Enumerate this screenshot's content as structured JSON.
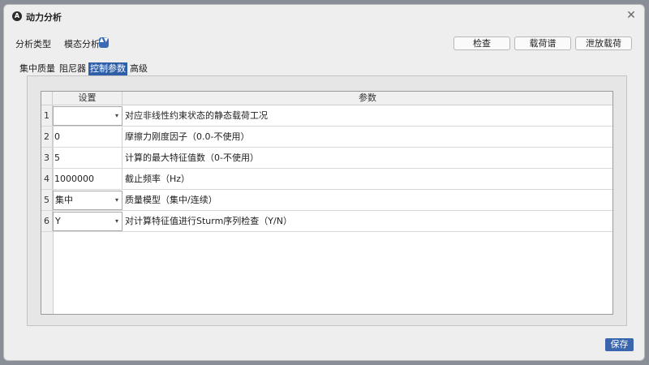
{
  "window": {
    "icon_glyph": "A",
    "title": "动力分析",
    "close_glyph": "✕"
  },
  "analysis_type": {
    "label": "分析类型",
    "value": "模态分析",
    "spin_glyph": "▲▼"
  },
  "toolbar": {
    "check_label": "检查",
    "load_spectrum_label": "载荷谱",
    "release_load_label": "泄放载荷"
  },
  "tabs": [
    {
      "label": "集中质量",
      "active": false
    },
    {
      "label": "阻尼器",
      "active": false
    },
    {
      "label": "控制参数",
      "active": true
    },
    {
      "label": "高级",
      "active": false
    }
  ],
  "table": {
    "headers": {
      "setting": "设置",
      "param": "参数"
    },
    "rows": [
      {
        "num": "1",
        "setting": "",
        "combo": true,
        "param": "对应非线性约束状态的静态载荷工况"
      },
      {
        "num": "2",
        "setting": "0",
        "combo": false,
        "param": "摩擦力刚度因子（0.0-不使用）"
      },
      {
        "num": "3",
        "setting": "5",
        "combo": false,
        "param": "计算的最大特征值数（0-不使用）"
      },
      {
        "num": "4",
        "setting": "1000000",
        "combo": false,
        "param": "截止频率（Hz）"
      },
      {
        "num": "5",
        "setting": "集中",
        "combo": true,
        "param": "质量模型（集中/连续）"
      },
      {
        "num": "6",
        "setting": "Y",
        "combo": true,
        "param": "对计算特征值进行Sturm序列检查（Y/N）"
      }
    ],
    "dropdown_glyph": "▾"
  },
  "footer": {
    "save_label": "保存"
  },
  "colors": {
    "accent": "#2f5fa8",
    "save_button": "#3a66ad"
  }
}
